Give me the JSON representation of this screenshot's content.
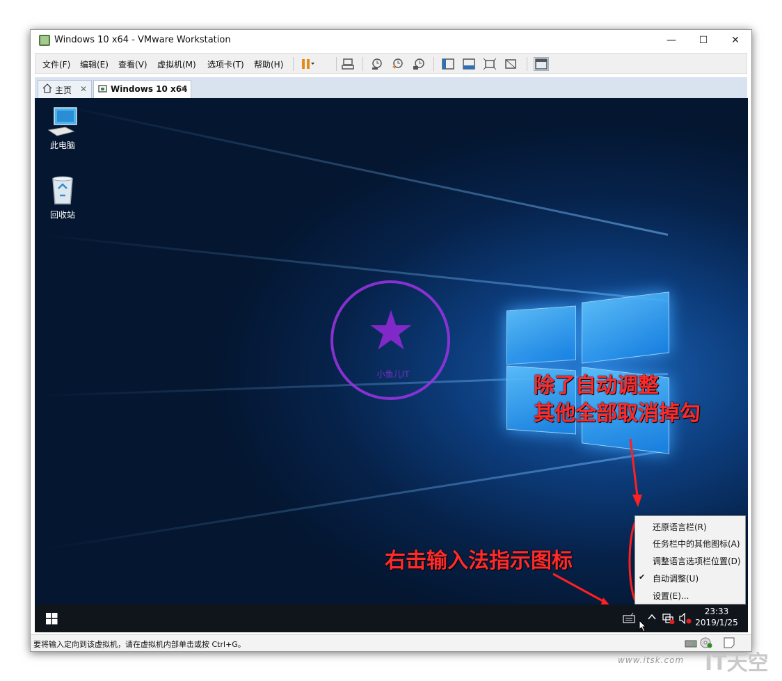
{
  "window": {
    "title": "Windows 10 x64 - VMware Workstation",
    "minimize": "—",
    "maximize": "☐",
    "close": "✕"
  },
  "menu": [
    "文件(F)",
    "编辑(E)",
    "查看(V)",
    "虚拟机(M)",
    "选项卡(T)",
    "帮助(H)"
  ],
  "tabs": [
    {
      "label": "主页",
      "close": "✕"
    },
    {
      "label": "Windows 10 x64",
      "close": "✕"
    }
  ],
  "desktop": {
    "icons": [
      "此电脑",
      "回收站"
    ]
  },
  "stamp": {
    "text": "小鱼儿IT"
  },
  "annotations": {
    "top_line1": "除了自动调整",
    "top_line2": "其他全部取消掉勾",
    "bottom": "右击输入法指示图标",
    "color": "#ff2a2a"
  },
  "context_menu": {
    "items": [
      "还原语言栏(R)",
      "任务栏中的其他图标(A)",
      "调整语言选项栏位置(D)",
      "自动调整(U)",
      "设置(E)..."
    ],
    "checked_index": 3,
    "check_mark": "✔"
  },
  "taskbar": {
    "time": "23:33",
    "date": "2019/1/25"
  },
  "statusbar": {
    "message": "要将输入定向到该虚拟机，请在虚拟机内部单击或按 Ctrl+G。"
  },
  "watermark": {
    "site": "www.itsk.com",
    "brand": "IT天空"
  }
}
